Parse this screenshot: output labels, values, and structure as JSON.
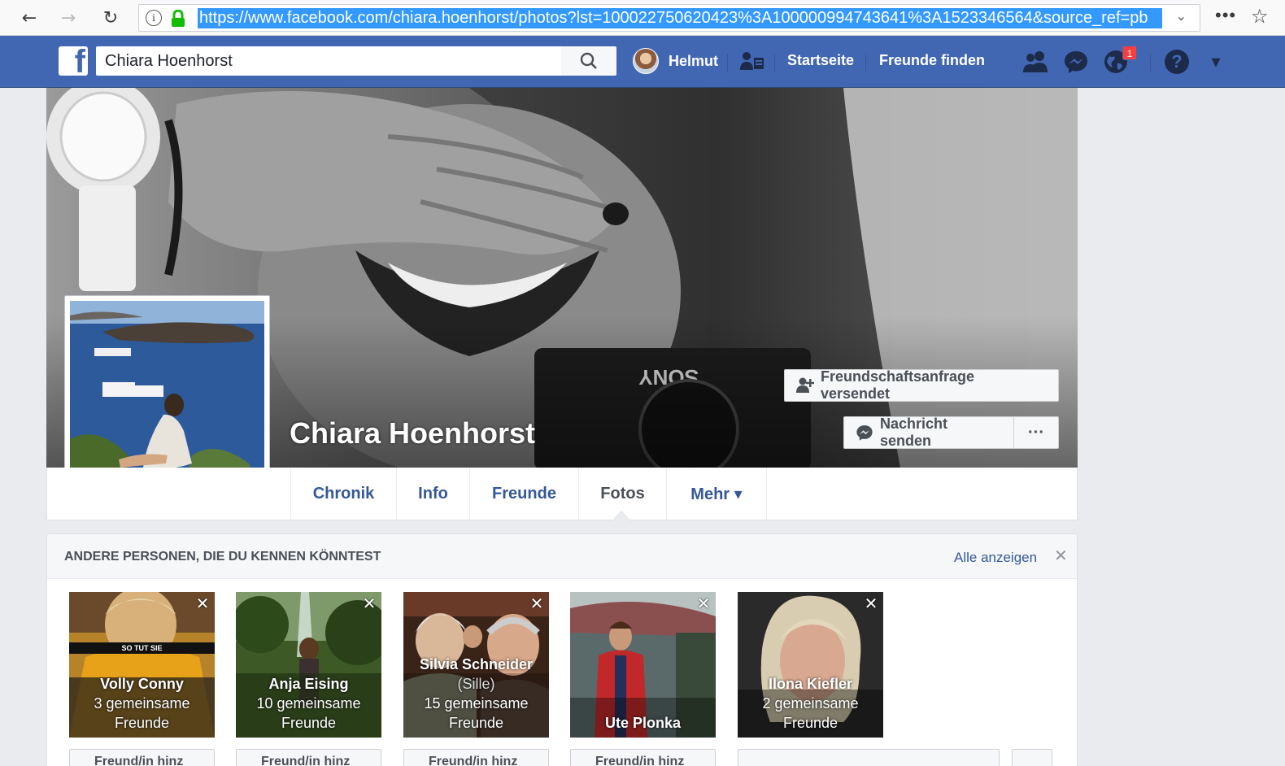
{
  "browser": {
    "url": "https://www.facebook.com/chiara.hoenhorst/photos?lst=100022750620423%3A100000994743641%3A1523346564&source_ref=pb",
    "back_glyph": "←",
    "forward_glyph": "→",
    "reload_glyph": "↻",
    "info_glyph": "i",
    "more_glyph": "•••",
    "star_glyph": "☆",
    "dropdown_glyph": "⌄"
  },
  "fb_header": {
    "logo": "f",
    "search_value": "Chiara Hoenhorst",
    "user_name": "Helmut",
    "home_link": "Startseite",
    "find_friends_link": "Freunde finden",
    "notification_count": "1",
    "help_glyph": "?",
    "menu_glyph": "▾",
    "brand_color": "#4267b2"
  },
  "profile": {
    "name": "Chiara Hoenhorst",
    "friend_request_button": "Freundschaftsanfrage versendet",
    "message_button": "Nachricht senden",
    "more_button": "···"
  },
  "tabs": [
    {
      "label": "Chronik",
      "active": false
    },
    {
      "label": "Info",
      "active": false
    },
    {
      "label": "Freunde",
      "active": false
    },
    {
      "label": "Fotos",
      "active": true
    },
    {
      "label": "Mehr ▾",
      "active": false
    }
  ],
  "pymk": {
    "title": "ANDERE PERSONEN, DIE DU KENNEN KÖNNTEST",
    "see_all": "Alle anzeigen",
    "close_glyph": "✕",
    "card_close_glyph": "✕",
    "add_button_label": "Freund/in hinz",
    "cards": [
      {
        "name": "Volly Conny",
        "sub": "",
        "mutual": "3 gemeinsame",
        "mutual2": "Freunde",
        "photo_caption": "SO TUT SIE"
      },
      {
        "name": "Anja Eising",
        "sub": "",
        "mutual": "10 gemeinsame",
        "mutual2": "Freunde"
      },
      {
        "name": "Silvia Schneider",
        "sub": "(Sille)",
        "mutual": "15 gemeinsame",
        "mutual2": "Freunde"
      },
      {
        "name": "Ute Plonka",
        "sub": "",
        "mutual": "",
        "mutual2": ""
      },
      {
        "name": "Ilona Kiefler",
        "sub": "",
        "mutual": "2 gemeinsame",
        "mutual2": "Freunde"
      }
    ]
  }
}
